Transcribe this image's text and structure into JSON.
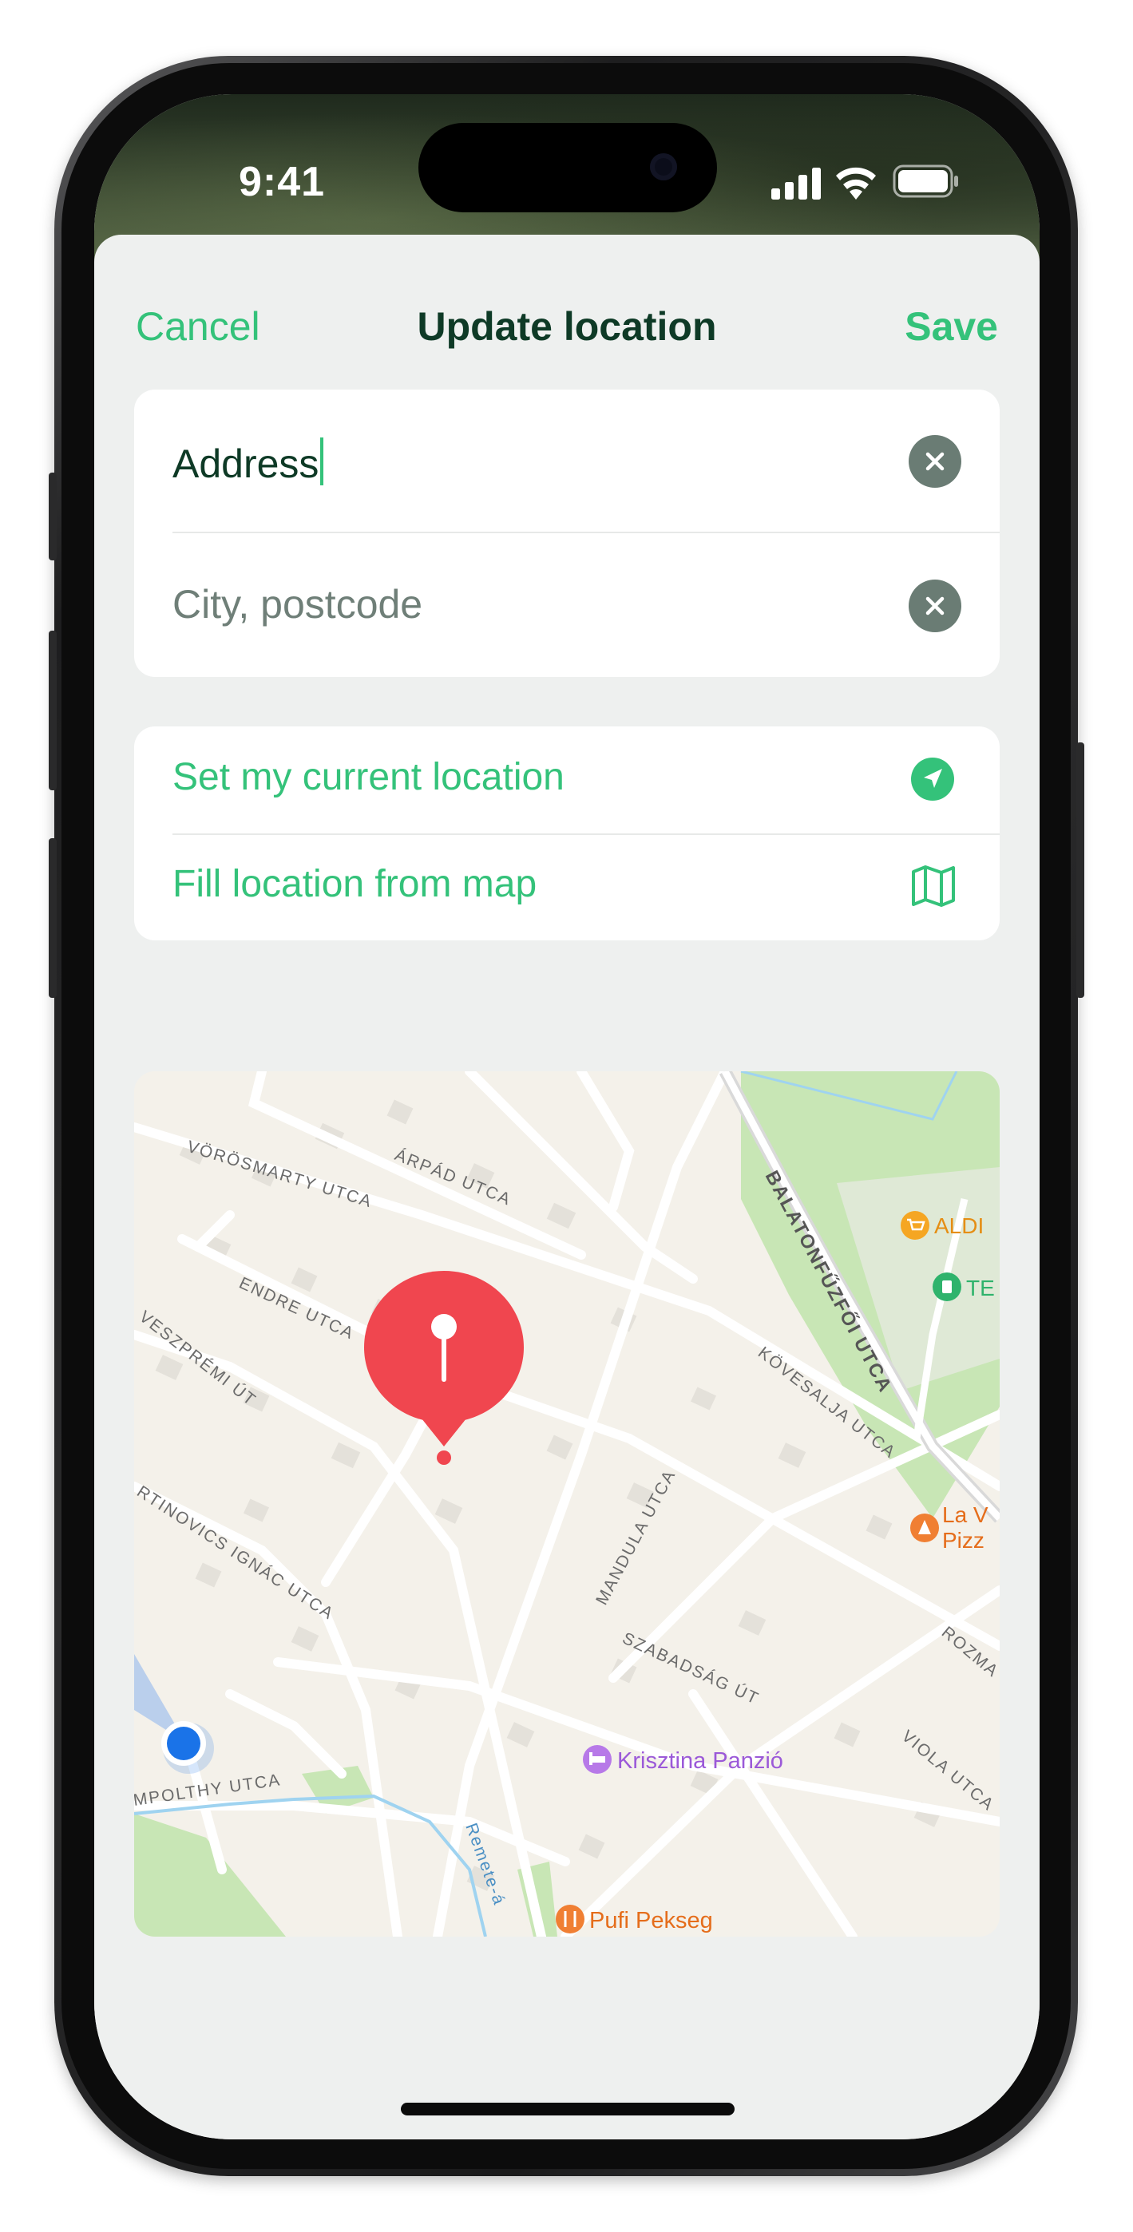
{
  "status_bar": {
    "time": "9:41"
  },
  "nav": {
    "cancel_label": "Cancel",
    "title": "Update location",
    "save_label": "Save"
  },
  "address_form": {
    "address_value": "Address",
    "city_placeholder": "City, postcode"
  },
  "actions": {
    "current_location_label": "Set my current location",
    "current_location_icon": "location-arrow-icon",
    "map_fill_label": "Fill location from map",
    "map_fill_icon": "map-icon"
  },
  "map": {
    "streets": [
      "VÖRÖSMARTY UTCA",
      "ÁRPÁD UTCA",
      "ENDRE UTCA",
      "VESZPRÉMI ÚT",
      "RTINOVICS IGNÁC UTCA",
      "BALATONFŰZFŐI UTCA",
      "KÖVESALJA UTCA",
      "MANDULA UTCA",
      "SZABADSÁG ÚT",
      "VIOLA UTCA",
      "ROZMA",
      "MPOLTHY UTCA",
      "Remete-á"
    ],
    "pois": {
      "aldi": "ALDI",
      "te": "TE",
      "pizza_line1": "La V",
      "pizza_line2": "Pizz",
      "hotel": "Krisztina Panzió",
      "bakery": "Pufi Pekseg"
    }
  },
  "colors": {
    "accent": "#34c27a",
    "title": "#0e3a26",
    "pin": "#f0464f",
    "user_location": "#1a73e8"
  }
}
